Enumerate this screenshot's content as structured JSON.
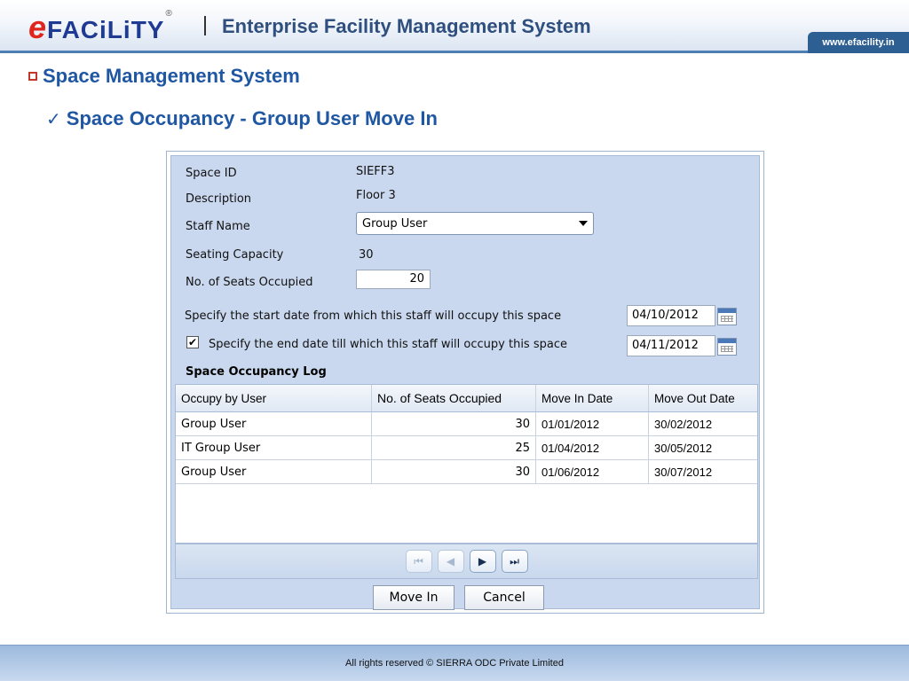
{
  "brand": {
    "logo_e": "e",
    "logo_text": "FACiLiTY",
    "logo_reg": "®",
    "title": "Enterprise Facility Management System",
    "website": "www.efacility.in"
  },
  "slide": {
    "heading": "Space Management System",
    "subheading": "Space Occupancy - Group User Move In"
  },
  "form": {
    "space_id_label": "Space ID",
    "space_id_value": "SIEFF3",
    "description_label": "Description",
    "description_value": "Floor 3",
    "staff_name_label": "Staff Name",
    "staff_name_value": "Group User",
    "seating_capacity_label": "Seating Capacity",
    "seating_capacity_value": "30",
    "seats_occupied_label": "No. of Seats Occupied",
    "seats_occupied_value": "20",
    "start_date_label": "Specify the start date from which this staff will occupy this space",
    "start_date_value": "04/10/2012",
    "end_date_label": "Specify the end date till which this staff will occupy this space",
    "end_date_value": "04/11/2012",
    "end_date_checked": "✔"
  },
  "log": {
    "title": "Space Occupancy Log",
    "columns": [
      "Occupy by User",
      "No. of Seats Occupied",
      "Move In Date",
      "Move Out Date"
    ],
    "rows": [
      [
        "Group User",
        "30",
        "01/01/2012",
        "30/02/2012"
      ],
      [
        "IT Group User",
        "25",
        "01/04/2012",
        "30/05/2012"
      ],
      [
        "Group User",
        "30",
        "01/06/2012",
        "30/07/2012"
      ]
    ]
  },
  "pager": {
    "first": "⏮",
    "prev": "◀",
    "next": "▶",
    "last": "⏭"
  },
  "actions": {
    "move_in": "Move In",
    "cancel": "Cancel"
  },
  "footer": {
    "text": "All rights reserved © SIERRA ODC Private Limited"
  },
  "colors": {
    "brand_blue": "#1f3a93",
    "brand_red": "#e0261c",
    "heading_blue": "#1f57a3",
    "panel_bg": "#c9d8ee"
  }
}
